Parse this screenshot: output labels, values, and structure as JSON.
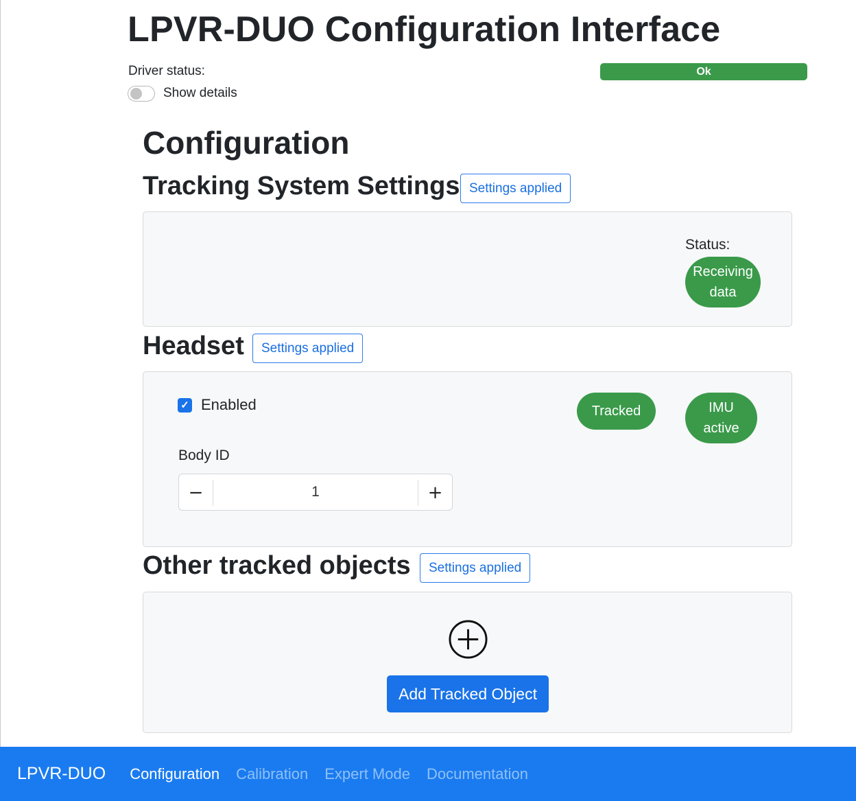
{
  "header": {
    "title": "LPVR-DUO Configuration Interface",
    "driver_status_label": "Driver status:",
    "driver_status_value": "Ok",
    "show_details_label": "Show details"
  },
  "colors": {
    "success": "#3a9a4a",
    "primary": "#1a73e8",
    "navbar": "#1a7bf0"
  },
  "configuration": {
    "heading": "Configuration",
    "tracking_system": {
      "heading": "Tracking System Settings",
      "applied_label": "Settings applied",
      "status_label": "Status:",
      "status_badge_line1": "Receiving",
      "status_badge_line2": "data"
    },
    "headset": {
      "heading": "Headset",
      "applied_label": "Settings applied",
      "enabled_label": "Enabled",
      "enabled": true,
      "body_id_label": "Body ID",
      "body_id_value": "1",
      "tracked_badge": "Tracked",
      "imu_badge_line1": "IMU",
      "imu_badge_line2": "active"
    },
    "other_objects": {
      "heading": "Other tracked objects",
      "applied_label": "Settings applied",
      "add_button_label": "Add Tracked Object"
    }
  },
  "navbar": {
    "brand": "LPVR-DUO",
    "links": [
      {
        "label": "Configuration",
        "active": true
      },
      {
        "label": "Calibration",
        "active": false
      },
      {
        "label": "Expert Mode",
        "active": false
      },
      {
        "label": "Documentation",
        "active": false
      }
    ]
  }
}
